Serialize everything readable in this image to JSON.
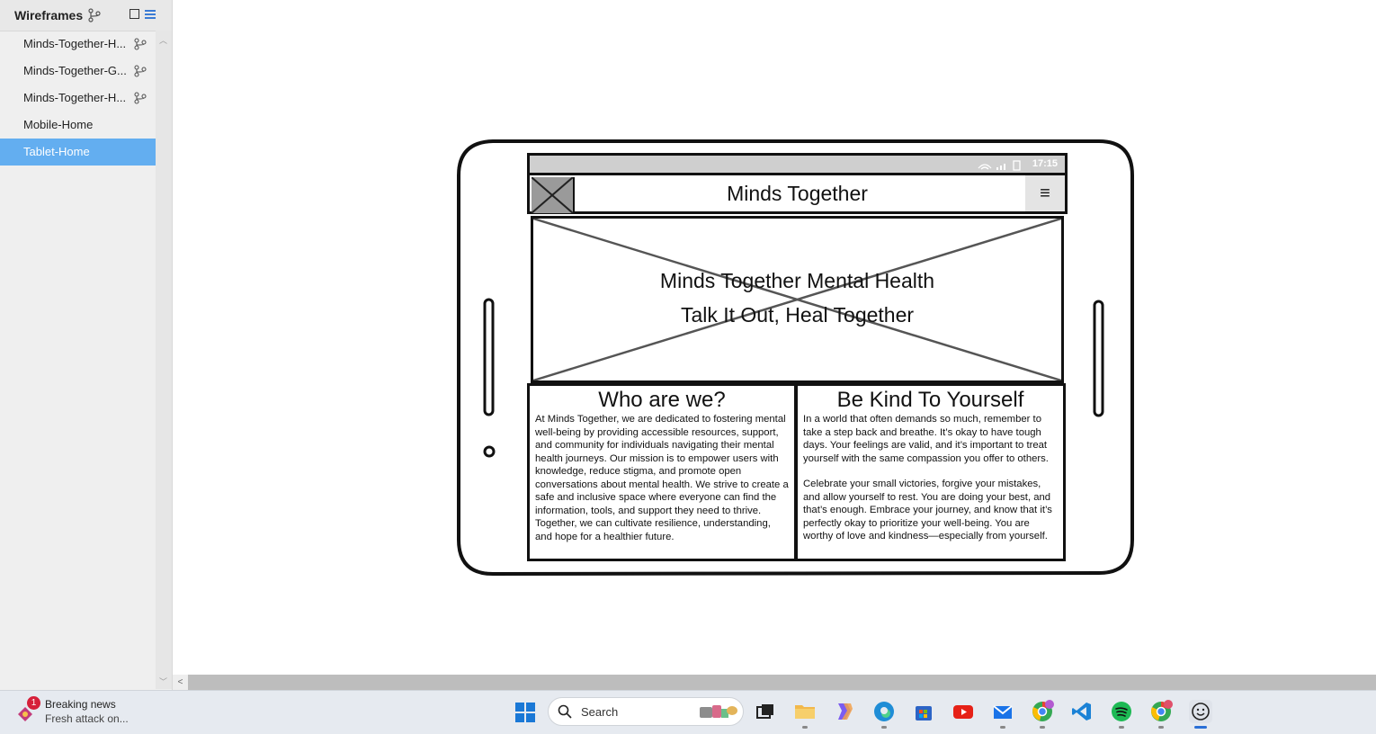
{
  "sidebar": {
    "title": "Wireframes",
    "pages": [
      {
        "label": "Minds-Together-H...",
        "has_branch": true,
        "selected": false
      },
      {
        "label": "Minds-Together-G...",
        "has_branch": true,
        "selected": false
      },
      {
        "label": "Minds-Together-H...",
        "has_branch": true,
        "selected": false
      },
      {
        "label": "Mobile-Home",
        "has_branch": false,
        "selected": false
      },
      {
        "label": "Tablet-Home",
        "has_branch": false,
        "selected": true
      }
    ]
  },
  "mockup": {
    "status_time": "17:15",
    "app_title": "Minds Together",
    "menu_glyph": "≡",
    "hero_title": "Minds Together Mental Health",
    "hero_subtitle": "Talk It Out, Heal Together",
    "left_card": {
      "heading": "Who are we?",
      "body": "At Minds Together, we are dedicated to fostering mental well-being by providing accessible resources, support, and community for individuals navigating their mental health journeys. Our mission is to empower users with knowledge, reduce stigma, and promote open conversations about mental health. We strive to create a safe and inclusive space where everyone can find the information, tools, and support they need to thrive. Together, we can cultivate resilience, understanding, and hope for a healthier future."
    },
    "right_card": {
      "heading": "Be Kind To Yourself",
      "body_1": "In a world that often demands so much, remember to take a step back and breathe. It’s okay to have tough days. Your feelings are valid, and it’s important to treat yourself with the same compassion you offer to others.",
      "body_2": "Celebrate your small victories, forgive your mistakes, and allow yourself to rest. You are doing your best, and that’s enough. Embrace your journey, and know that it’s perfectly okay to prioritize your well-being. You are worthy of love and kindness—especially from yourself."
    }
  },
  "taskbar": {
    "news_badge": "1",
    "news_title": "Breaking news",
    "news_subtitle": "Fresh attack on...",
    "search_label": "Search",
    "apps": [
      {
        "name": "task-view",
        "color": "#333333"
      },
      {
        "name": "file-explorer",
        "color": "#f2b84b"
      },
      {
        "name": "copilot",
        "color": "#7b5cf0"
      },
      {
        "name": "edge",
        "color": "#1f8dd6"
      },
      {
        "name": "microsoft-store",
        "color": "#2c64c6"
      },
      {
        "name": "youtube",
        "color": "#e62117"
      },
      {
        "name": "mail",
        "color": "#1a73e8"
      },
      {
        "name": "chrome-profile-t",
        "color": "#34a853"
      },
      {
        "name": "vscode",
        "color": "#1b82d6"
      },
      {
        "name": "spotify",
        "color": "#1db954"
      },
      {
        "name": "chrome-profile-t2",
        "color": "#ea4335"
      },
      {
        "name": "balsamiq",
        "color": "#444444"
      }
    ]
  }
}
